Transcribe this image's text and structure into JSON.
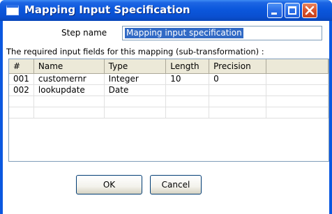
{
  "window": {
    "title": "Mapping Input Specification"
  },
  "form": {
    "step_name_label": "Step name",
    "step_name_value": "Mapping input specification",
    "description": "The required input fields for this mapping (sub-transformation) :"
  },
  "table": {
    "columns": [
      "#",
      "Name",
      "Type",
      "Length",
      "Precision"
    ],
    "rows": [
      [
        "001",
        "customernr",
        "Integer",
        "10",
        "0"
      ],
      [
        "002",
        "lookupdate",
        "Date",
        "",
        ""
      ]
    ]
  },
  "buttons": {
    "ok": "OK",
    "cancel": "Cancel"
  },
  "icons": {
    "app": "window-icon",
    "minimize": "minimize-icon",
    "maximize": "maximize-icon",
    "close": "close-icon"
  },
  "colors": {
    "titlebar": "#0a58e0",
    "close_button": "#d8522d",
    "selection": "#316ac5"
  }
}
